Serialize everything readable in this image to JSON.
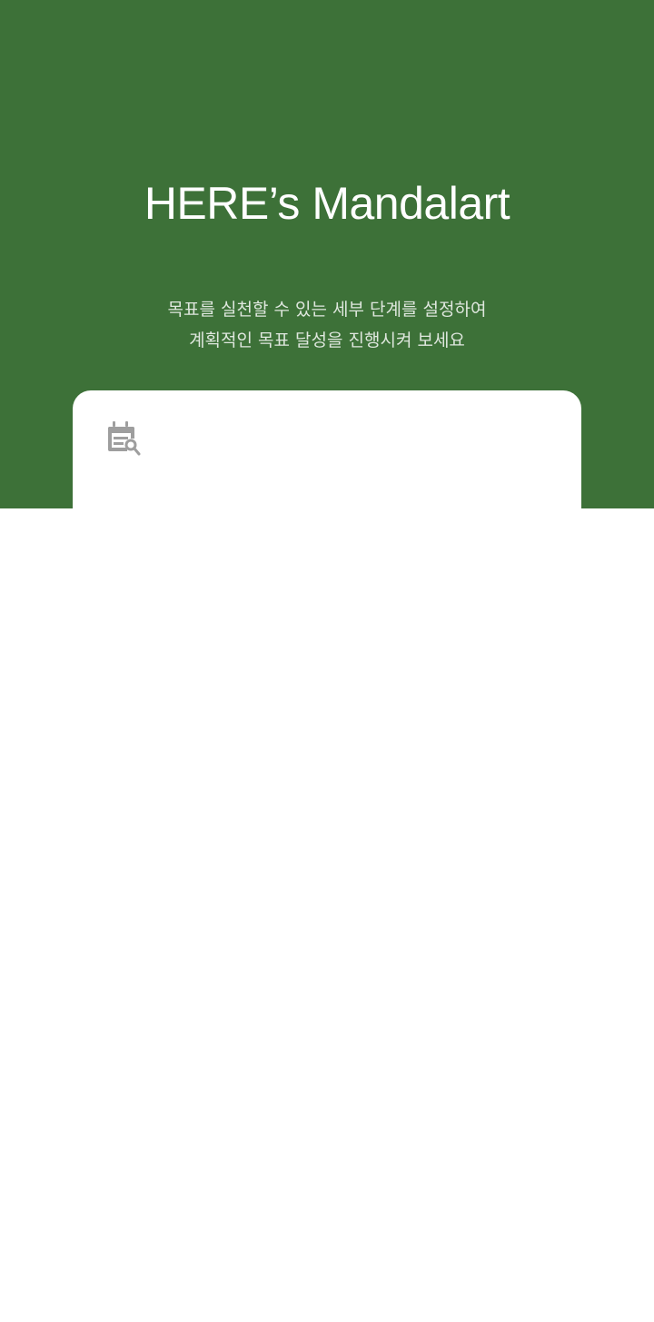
{
  "header": {
    "title": "HERE’s Mandalart",
    "subtitle_line1": "목표를 실천할 수 있는 세부 단계를 설정하여",
    "subtitle_line2": "계획적인 목표 달성을 진행시켜 보세요"
  },
  "card": {
    "icon": "calendar-edit-icon"
  },
  "colors": {
    "hero_background": "#3d7138",
    "title_text": "#ffffff",
    "subtitle_text": "#dfe7de",
    "card_background": "#ffffff",
    "icon_color": "#9e9e9e"
  }
}
